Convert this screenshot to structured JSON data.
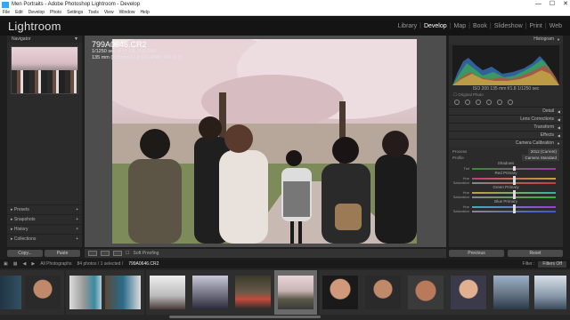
{
  "window": {
    "title": "Men Portraits - Adobe Photoshop Lightroom - Develop",
    "controls": [
      "—",
      "☐",
      "✕"
    ]
  },
  "menu": [
    "File",
    "Edit",
    "Develop",
    "Photo",
    "Settings",
    "Tools",
    "View",
    "Window",
    "Help"
  ],
  "app": {
    "logo": "Lightroom"
  },
  "modules": [
    {
      "label": "Library",
      "active": false
    },
    {
      "label": "Develop",
      "active": true
    },
    {
      "label": "Map",
      "active": false
    },
    {
      "label": "Book",
      "active": false
    },
    {
      "label": "Slideshow",
      "active": false
    },
    {
      "label": "Print",
      "active": false
    },
    {
      "label": "Web",
      "active": false
    }
  ],
  "left_panel": {
    "navigator": "Navigator",
    "sections": [
      "Presets",
      "Snapshots",
      "History",
      "Collections"
    ],
    "copy_label": "Copy...",
    "paste_label": "Paste"
  },
  "photo_info": {
    "filename": "799A0646.CR2",
    "exposure": "1/1250 sec at f / 1.8, ISO 200",
    "lens": "135 mm (135mm F1.8 DG HSM | Art 017)"
  },
  "toolbar": {
    "soft_proofing": "Soft Proofing"
  },
  "right_panel": {
    "histogram_label": "Histogram",
    "histogram_readout": "ISO 200   135 mm   f/1.8   1/1250 sec",
    "original_photo": "Original Photo",
    "sections": [
      "Detail",
      "Lens Corrections",
      "Transform",
      "Effects",
      "Camera Calibration"
    ],
    "process_label": "Process",
    "process_value": "2012 (Current)",
    "profile_label": "Profile",
    "profile_value": "Camera Standard",
    "shadows_label": "Shadows",
    "red_label": "Red Primary",
    "green_label": "Green Primary",
    "blue_label": "Blue Primary",
    "tint_label": "Tint",
    "hue_label": "Hue",
    "saturation_label": "Saturation",
    "previous_label": "Previous",
    "reset_label": "Reset",
    "slider_positions": [
      0.5,
      0.5,
      0.5,
      0.5,
      0.5,
      0.5,
      0.5
    ]
  },
  "filmstrip_bar": {
    "source": "All Photographs",
    "count": "84 photos / 1 selected /",
    "current": "799A0646.CR2",
    "filter_label": "Filter :",
    "filter_value": "Filters Off"
  },
  "colors": {
    "accent": "#ffffff",
    "panel": "#2b2b2b",
    "background": "#1e1e1e",
    "selected_cell": "#6a6a6a"
  }
}
